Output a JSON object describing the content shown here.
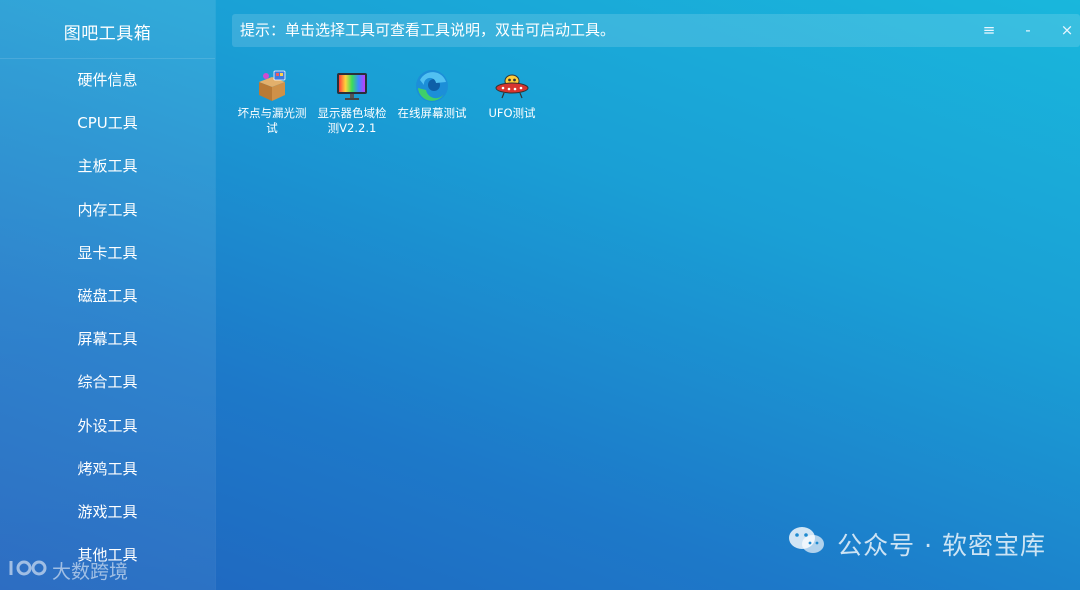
{
  "app": {
    "title": "图吧工具箱"
  },
  "sidebar": {
    "items": [
      {
        "label": "硬件信息"
      },
      {
        "label": "CPU工具"
      },
      {
        "label": "主板工具"
      },
      {
        "label": "内存工具"
      },
      {
        "label": "显卡工具"
      },
      {
        "label": "磁盘工具"
      },
      {
        "label": "屏幕工具"
      },
      {
        "label": "综合工具"
      },
      {
        "label": "外设工具"
      },
      {
        "label": "烤鸡工具"
      },
      {
        "label": "游戏工具"
      },
      {
        "label": "其他工具"
      }
    ]
  },
  "topbar": {
    "hint": "提示：单击选择工具可查看工具说明，双击可启动工具。",
    "menu_symbol": "≡",
    "minimize_symbol": "-",
    "close_symbol": "×"
  },
  "tools": [
    {
      "line1": "坏点与漏光测",
      "line2": "试",
      "icon": "package-box-icon"
    },
    {
      "line1": "显示器色域检",
      "line2": "测V2.2.1",
      "icon": "color-monitor-icon"
    },
    {
      "line1": "在线屏幕测试",
      "line2": "",
      "icon": "edge-browser-icon"
    },
    {
      "line1": "UFO测试",
      "line2": "",
      "icon": "ufo-icon"
    }
  ],
  "watermark": {
    "text": "公众号 · 软密宝库",
    "icon": "wechat-icon"
  },
  "corner_logo": {
    "text": "大数跨境",
    "icon": "brand-logo-icon"
  }
}
